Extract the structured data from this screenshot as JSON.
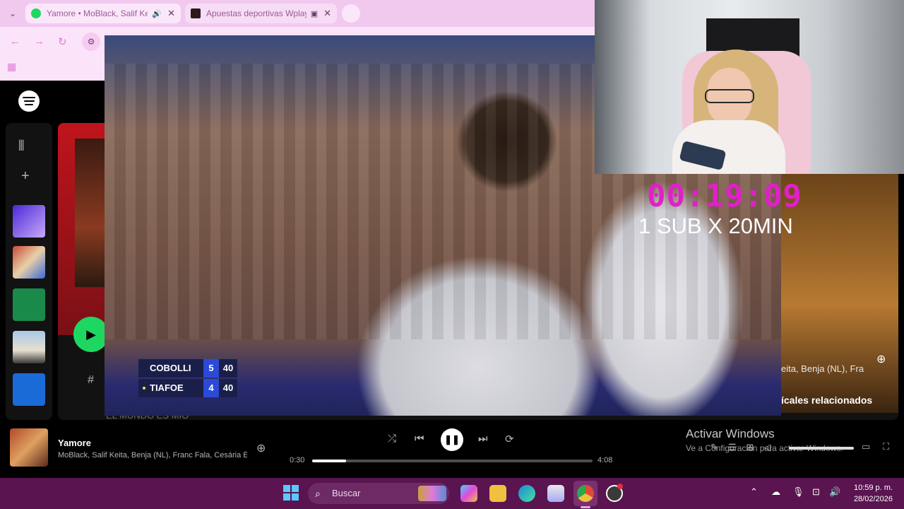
{
  "browser": {
    "tabs": [
      {
        "title": "Yamore • MoBlack, Salif Keita",
        "favicon_color": "#1ed760"
      },
      {
        "title": "Apuestas deportivas Wplay",
        "favicon_color": "#2a1a1a"
      }
    ],
    "menu_icon": "chevron-down-icon",
    "nav_icons": [
      "back-icon",
      "forward-icon",
      "reload-icon"
    ]
  },
  "spotify": {
    "related_label": "ícales relacionados",
    "list_ghost_text": "EL MUNDO ES MIO",
    "col_hash": "#",
    "now_playing": {
      "title": "Yamore",
      "artists": "MoBlack, Salif Keita, Benja (NL), Franc Fala, Cesária Évora",
      "elapsed": "0:30",
      "duration": "4:08",
      "progress": 0.12
    },
    "behind_text": "eita, Benja (NL), Fra"
  },
  "windows_watermark": {
    "title": "Activar Windows",
    "subtitle": "Ve a Configuración para activar Windows."
  },
  "video": {
    "scoreboard": [
      {
        "player": "COBOLLI",
        "games": "5",
        "points": "40",
        "serving": false
      },
      {
        "player": "TIAFOE",
        "games": "4",
        "points": "40",
        "serving": true
      }
    ]
  },
  "stream_overlay": {
    "timer": "00:19:09",
    "promo": "1 SUB X 20MIN"
  },
  "taskbar": {
    "search_placeholder": "Buscar",
    "time": "10:59 p. m.",
    "date": "28/02/2026"
  },
  "colors": {
    "accent_green": "#1ed760",
    "timer_magenta": "#e020c8",
    "taskbar": "#5a1450",
    "scoreboard_blue": "#2b4ad8"
  }
}
